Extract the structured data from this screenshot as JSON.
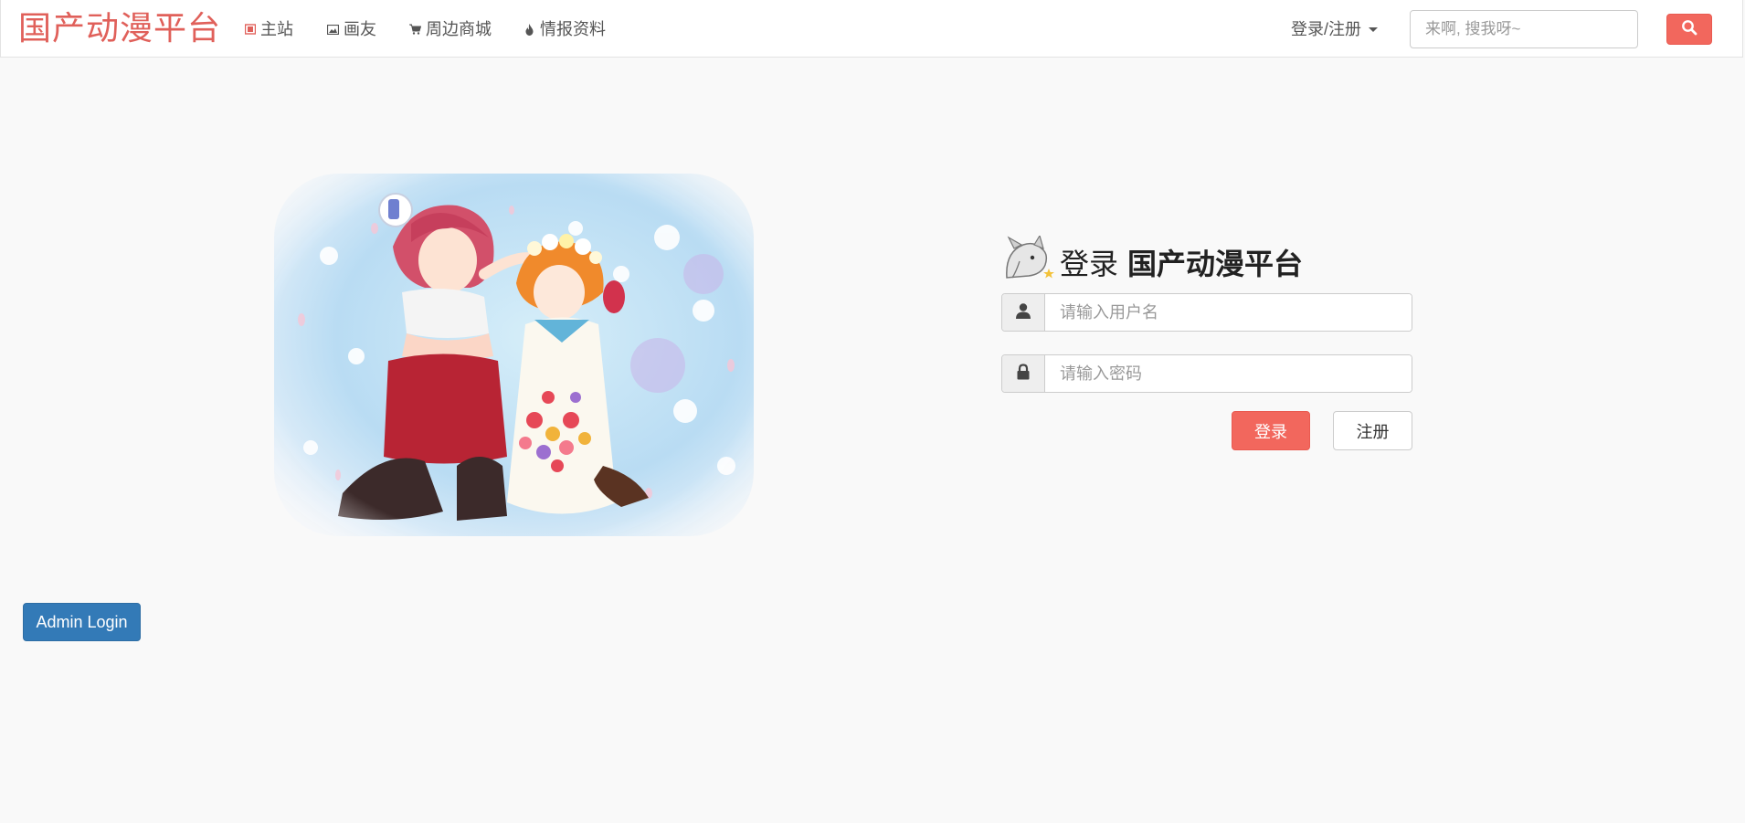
{
  "navbar": {
    "brand": "国产动漫平台",
    "items": [
      {
        "label": "主站",
        "icon": "film-icon"
      },
      {
        "label": "画友",
        "icon": "picture-icon"
      },
      {
        "label": "周边商城",
        "icon": "cart-icon"
      },
      {
        "label": "情报资料",
        "icon": "fire-icon"
      }
    ],
    "login_register": "登录/注册",
    "search_placeholder": "来啊, 搜我呀~"
  },
  "login": {
    "title_prefix": "登录",
    "title_brand": "国产动漫平台",
    "username_placeholder": "请输入用户名",
    "password_placeholder": "请输入密码",
    "login_button": "登录",
    "register_button": "注册"
  },
  "admin_button": "Admin Login",
  "colors": {
    "brand": "#e0605a",
    "accent": "#f2675d",
    "admin": "#337ab7"
  }
}
